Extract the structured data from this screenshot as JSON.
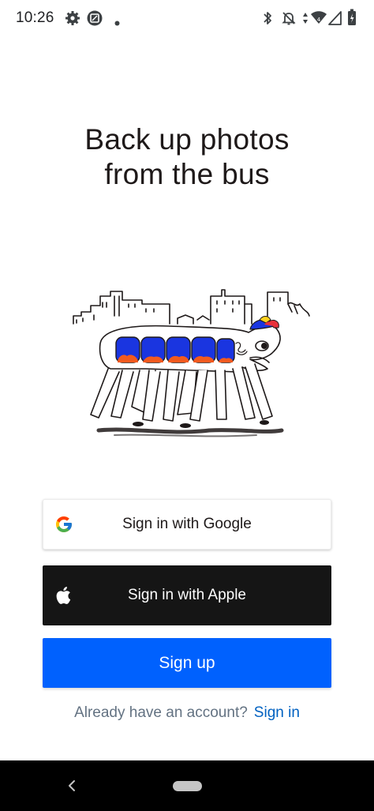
{
  "status_bar": {
    "time": "10:26",
    "left_icons": [
      "settings-icon",
      "screenshot-icon",
      "notification-dot-icon"
    ],
    "right_icons": [
      "bluetooth-icon",
      "notifications-off-icon",
      "data-arrows-icon",
      "wifi-icon",
      "signal-icon",
      "battery-icon"
    ]
  },
  "headline": {
    "line1": "Back up photos",
    "line2": "from the bus"
  },
  "illustration": {
    "name": "walking-bus-illustration",
    "colors": {
      "window_blue": "#1a35e0",
      "window_orange": "#f25a1f",
      "cap_red": "#e8313a",
      "cap_yellow": "#ffd21e",
      "ink": "#1e1919"
    }
  },
  "buttons": {
    "google": {
      "label": "Sign in with Google",
      "icon": "google-icon"
    },
    "apple": {
      "label": "Sign in with Apple",
      "icon": "apple-icon"
    },
    "signup": {
      "label": "Sign up"
    }
  },
  "footer": {
    "prompt": "Already have an account?",
    "link": "Sign in"
  },
  "colors": {
    "primary_blue": "#0061fe",
    "link_blue": "#0061c1",
    "apple_black": "#151515",
    "muted_text": "#637282"
  },
  "nav_bar": {
    "icons": [
      "back-icon",
      "home-pill-icon"
    ]
  }
}
